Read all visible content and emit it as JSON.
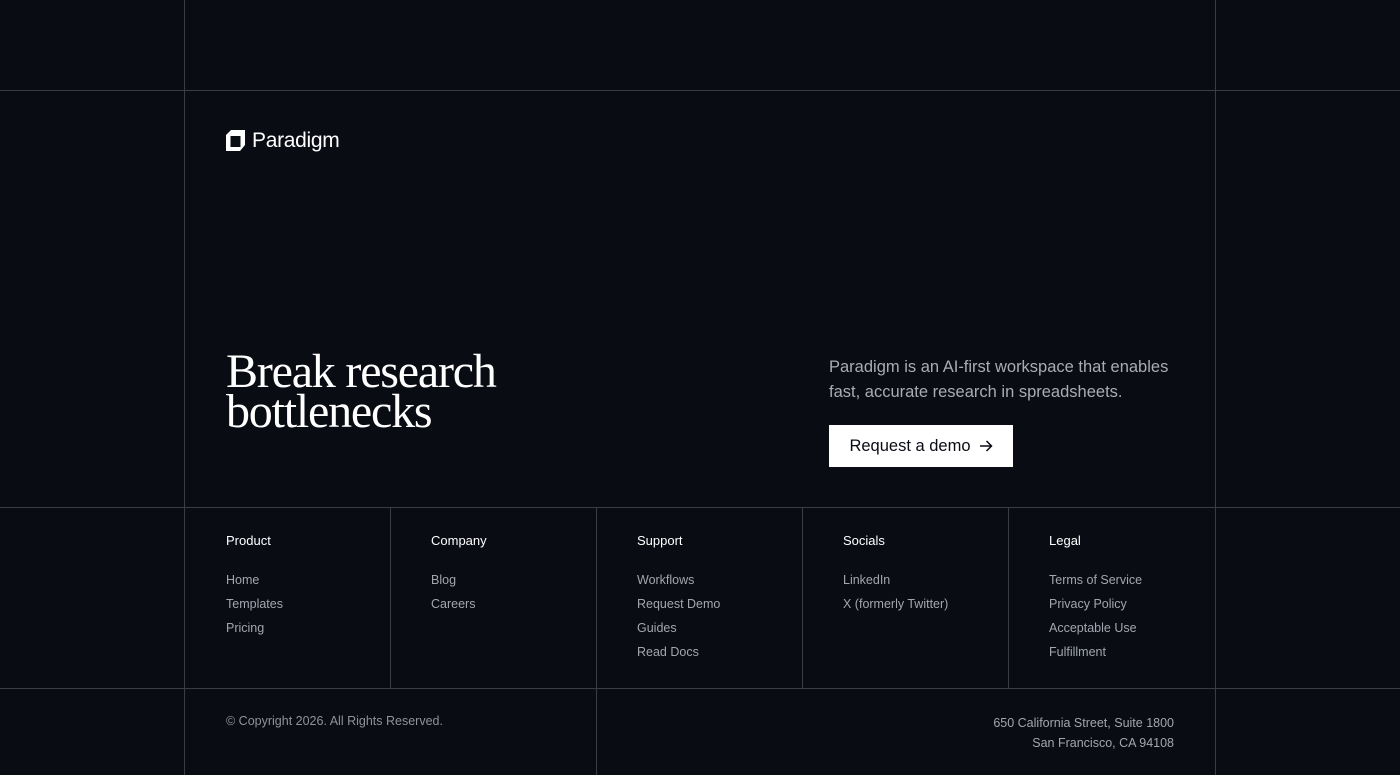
{
  "brand": {
    "name": "Paradigm"
  },
  "hero": {
    "headline_line1": "Break research",
    "headline_line2": "bottlenecks",
    "description": "Paradigm is an AI-first workspace that enables fast, accurate research in spreadsheets.",
    "cta_label": "Request a demo",
    "cta_icon": "arrow-right-icon"
  },
  "footer": {
    "columns": [
      {
        "title": "Product",
        "links": [
          "Home",
          "Templates",
          "Pricing"
        ]
      },
      {
        "title": "Company",
        "links": [
          "Blog",
          "Careers"
        ]
      },
      {
        "title": "Support",
        "links": [
          "Workflows",
          "Request Demo",
          "Guides",
          "Read Docs"
        ]
      },
      {
        "title": "Socials",
        "links": [
          "LinkedIn",
          "X (formerly Twitter)"
        ]
      },
      {
        "title": "Legal",
        "links": [
          "Terms of Service",
          "Privacy Policy",
          "Acceptable Use",
          "Fulfillment"
        ]
      }
    ],
    "copyright": "© Copyright 2026. All Rights Reserved.",
    "address_line1": "650 California Street, Suite 1800",
    "address_line2": "San Francisco, CA 94108"
  },
  "colors": {
    "background": "#0a0c14",
    "grid_line": "#3a3d47",
    "text_primary": "#ffffff",
    "text_muted": "#a3a6b0",
    "cta_background": "#ffffff"
  }
}
